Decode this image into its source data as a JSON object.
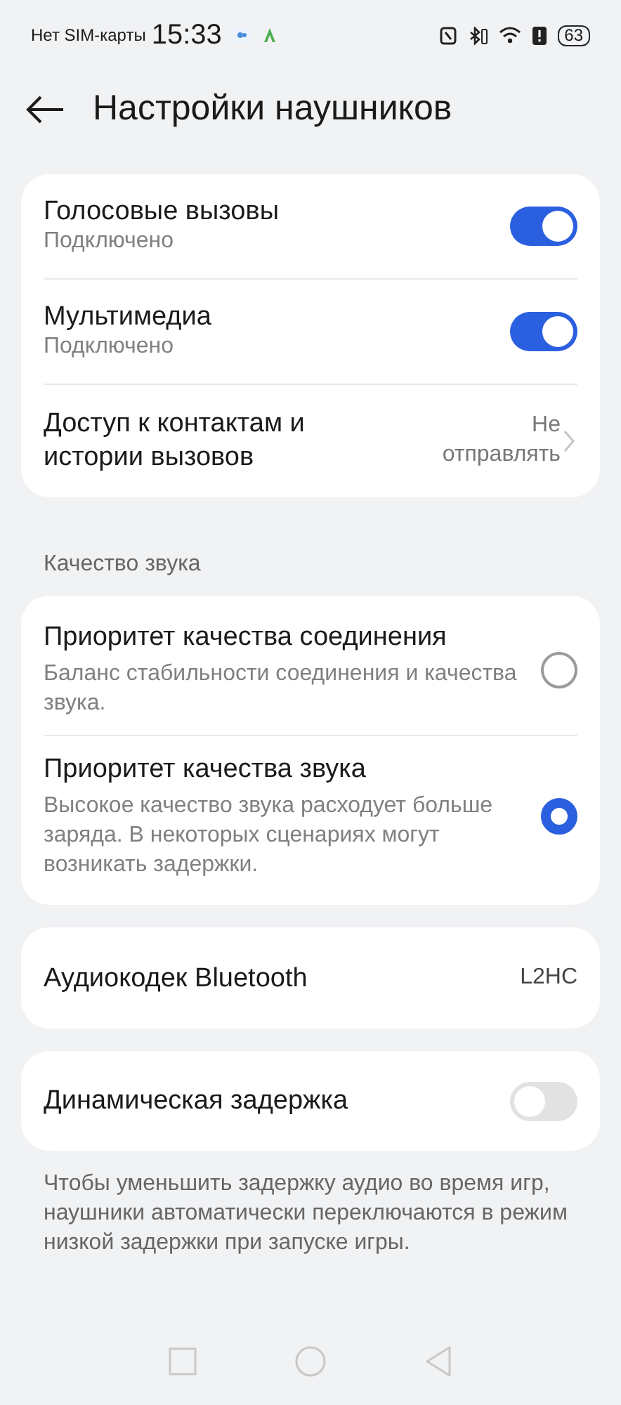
{
  "status_bar": {
    "carrier": "Нет SIM-карты",
    "time": "15:33",
    "battery": "63"
  },
  "header": {
    "title": "Настройки наушников"
  },
  "connections": [
    {
      "kind": "toggle",
      "title": "Голосовые вызовы",
      "subtitle": "Подключено",
      "on": true
    },
    {
      "kind": "toggle",
      "title": "Мультимедиа",
      "subtitle": "Подключено",
      "on": true
    },
    {
      "kind": "link",
      "title": "Доступ к контактам и истории вызовов",
      "value": "Не отправлять"
    }
  ],
  "sound_quality": {
    "label": "Качество звука",
    "options": [
      {
        "title": "Приоритет качества соединения",
        "description": "Баланс стабильности соединения и качества звука.",
        "selected": false
      },
      {
        "title": "Приоритет качества звука",
        "description": "Высокое качество звука расходует больше заряда. В некоторых сценариях могут возникать задержки.",
        "selected": true
      }
    ]
  },
  "codec": {
    "title": "Аудиокодек Bluetooth",
    "value": "L2HC"
  },
  "dynamic_latency": {
    "title": "Динамическая задержка",
    "on": false,
    "description": "Чтобы уменьшить задержку аудио во время игр, наушники автоматически переключаются в режим низкой задержки при запуске игры."
  }
}
